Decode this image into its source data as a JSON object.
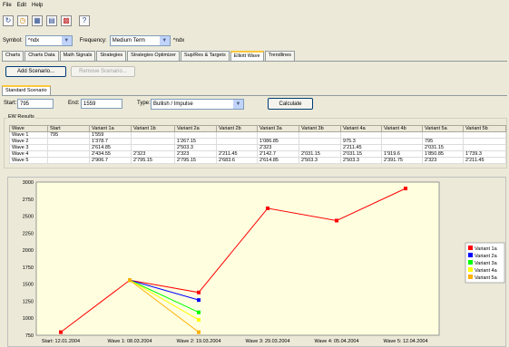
{
  "menu": [
    "File",
    "Edit",
    "Help"
  ],
  "toolbar": {
    "icons": [
      "refresh-icon",
      "clock-icon",
      "grid-icon",
      "calculator-icon",
      "calendar-icon",
      "help-icon"
    ]
  },
  "symbol": {
    "label": "Symbol:",
    "value": "^ndx",
    "frequency_label": "Frequency:",
    "frequency_value": "Medium Term",
    "extra": "^ndx"
  },
  "main_tabs": [
    "Charts",
    "Charts Data",
    "Math Signals",
    "Strategies",
    "Strategies Optimizer",
    "Sup/Res & Targets",
    "Elliott Wave",
    "Trendlines"
  ],
  "main_tab_active": 6,
  "scenario_buttons": {
    "add": "Add Scenario...",
    "remove": "Remove Scenario..."
  },
  "scenario_tabs": [
    "Standard Scenario"
  ],
  "form": {
    "start_label": "Start:",
    "start_value": "795",
    "end_label": "End:",
    "end_value": "1559",
    "type_label": "Type:",
    "type_value": "Bullish / Impulse",
    "calculate": "Calculate"
  },
  "results": {
    "label": "EW Results",
    "columns": [
      "Wave",
      "Start",
      "Variant 1a",
      "Variant 1b",
      "Variant 2a",
      "Variant 2b",
      "Variant 3a",
      "Variant 3b",
      "Variant 4a",
      "Variant 4b",
      "Variant 5a",
      "Variant 5b"
    ],
    "rows": [
      [
        "Wave 1",
        "795",
        "1'559",
        "",
        "",
        "",
        "",
        "",
        "",
        "",
        "",
        ""
      ],
      [
        "Wave 2",
        "",
        "1'378.7",
        "",
        "1'267.15",
        "",
        "1'086.85",
        "",
        "975.3",
        "",
        "795",
        ""
      ],
      [
        "Wave 3",
        "",
        "2'614.85",
        "",
        "2'503.3",
        "",
        "2'323",
        "",
        "2'211.45",
        "",
        "2'031.15",
        ""
      ],
      [
        "Wave 4",
        "",
        "2'434.55",
        "2'323",
        "2'323",
        "2'211.45",
        "2'142.7",
        "2'031.15",
        "2'031.15",
        "1'919.6",
        "1'850.85",
        "1'739.3"
      ],
      [
        "Wave 5",
        "",
        "2'906.7",
        "2'795.15",
        "2'795.15",
        "2'683.6",
        "2'614.85",
        "2'503.3",
        "2'503.3",
        "2'391.75",
        "2'323",
        "2'211.45"
      ]
    ]
  },
  "chart_data": {
    "type": "line",
    "ylim": [
      750,
      3000
    ],
    "y_ticks": [
      "3000",
      "2750",
      "2500",
      "2250",
      "2000",
      "1750",
      "1500",
      "1250",
      "1000",
      "750"
    ],
    "x_labels": [
      "Start: 12.01.2004",
      "Wave 1: 08.03.2004",
      "Wave 2: 19.03.2004",
      "Wave 3: 29.03.2004",
      "Wave 4: 05.04.2004",
      "Wave 5: 12.04.2004"
    ],
    "series": [
      {
        "name": "Variant 1a",
        "color": "#ff0000",
        "values": [
          795,
          1559,
          1378.7,
          2614.85,
          2434.55,
          2906.7
        ]
      },
      {
        "name": "Variant 2a",
        "color": "#0000ff",
        "values": [
          null,
          1559,
          1267.15,
          null,
          null,
          null
        ]
      },
      {
        "name": "Variant 3a",
        "color": "#00ff00",
        "values": [
          null,
          1559,
          1086.85,
          null,
          null,
          null
        ]
      },
      {
        "name": "Variant 4a",
        "color": "#ffff00",
        "values": [
          null,
          1559,
          975.3,
          null,
          null,
          null
        ]
      },
      {
        "name": "Variant 5a",
        "color": "#ffb000",
        "values": [
          null,
          1559,
          795,
          null,
          null,
          null
        ]
      }
    ]
  }
}
